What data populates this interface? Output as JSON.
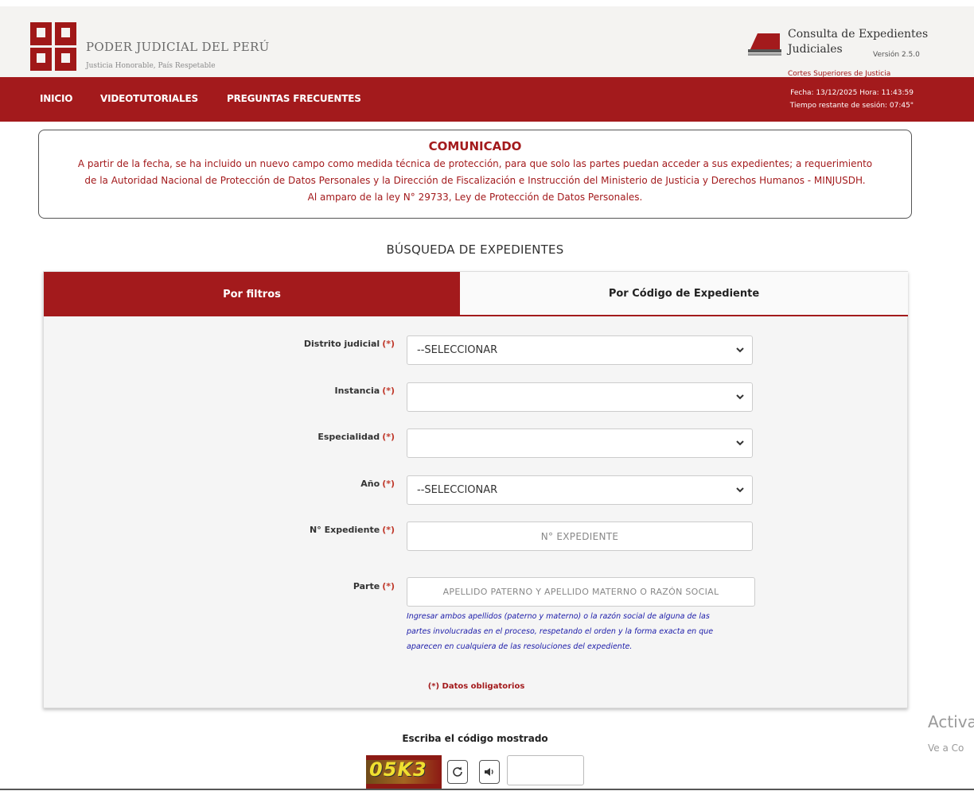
{
  "header": {
    "brand_name": "PODER JUDICIAL DEL PERÚ",
    "brand_slogan": "Justicia Honorable, País Respetable",
    "app_title_line1": "Consulta de Expedientes",
    "app_title_line2": "Judiciales",
    "app_version": "Versión 2.5.0",
    "app_cortes": "Cortes Superiores de Justicia"
  },
  "nav": {
    "items": [
      "INICIO",
      "VIDEOTUTORIALES",
      "PREGUNTAS FRECUENTES"
    ],
    "session_date": "Fecha: 13/12/2025 Hora: 11:43:59",
    "session_remaining": "Tiempo restante de sesión: 07:45\""
  },
  "notice": {
    "title": "COMUNICADO",
    "line1": "A partir de la fecha, se ha incluido un nuevo campo como medida técnica de protección, para que solo las partes puedan acceder a sus expedientes; a requerimiento",
    "line2": "de la Autoridad Nacional de Protección de Datos Personales y la Dirección de Fiscalización e Instrucción del Ministerio de Justicia y Derechos Humanos - MINJUSDH.",
    "line3": "Al amparo de la ley N° 29733, Ley de Protección de Datos Personales."
  },
  "search": {
    "heading": "BÚSQUEDA DE EXPEDIENTES",
    "tabs": [
      "Por filtros",
      "Por Código de Expediente"
    ],
    "required_marker": "(*)",
    "fields": {
      "distrito": {
        "label": "Distrito judicial",
        "value": "--SELECCIONAR"
      },
      "instancia": {
        "label": "Instancia",
        "value": ""
      },
      "especialidad": {
        "label": "Especialidad",
        "value": ""
      },
      "anio": {
        "label": "Año",
        "value": "--SELECCIONAR"
      },
      "expediente": {
        "label": "N° Expediente",
        "placeholder": "N° EXPEDIENTE"
      },
      "parte": {
        "label": "Parte",
        "placeholder": "APELLIDO PATERNO Y APELLIDO MATERNO O RAZÓN SOCIAL"
      }
    },
    "hint_line1": "Ingresar ambos apellidos (paterno y materno) o la razón social de alguna de las",
    "hint_line2": "partes involucradas en el proceso, respetando el orden y la forma exacta en que",
    "hint_line3": "aparecen en cualquiera de las resoluciones del expediente.",
    "required_note": "(*) Datos obligatorios"
  },
  "captcha": {
    "label": "Escriba el código mostrado",
    "code": "05K3",
    "refresh_icon": "refresh-icon",
    "audio_icon": "speaker-icon"
  },
  "watermark": {
    "title": "Activa",
    "subtitle": "Ve a Co"
  },
  "colors": {
    "brand_red": "#a31a1c",
    "hint_blue": "#1a1aa8"
  }
}
